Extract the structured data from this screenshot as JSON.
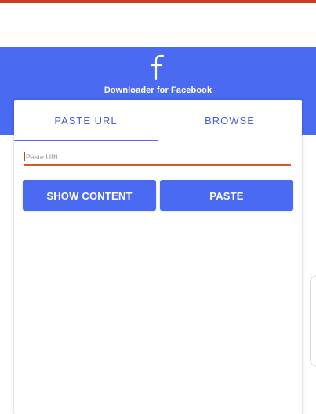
{
  "app": {
    "title": "Downloader for Facebook",
    "logo_glyph": "f"
  },
  "tabs": [
    {
      "label": "PASTE URL",
      "selected": true
    },
    {
      "label": "BROWSE",
      "selected": false
    }
  ],
  "url_input": {
    "placeholder": "Paste URL...",
    "value": ""
  },
  "buttons": {
    "show_content": "SHOW CONTENT",
    "paste": "PASTE"
  },
  "colors": {
    "primary": "#4a6af2",
    "accent": "#d4552f",
    "tab_text": "#4a5fd0",
    "top_strip": "#c8401e"
  },
  "icons": {
    "logo": "facebook-f-icon"
  }
}
